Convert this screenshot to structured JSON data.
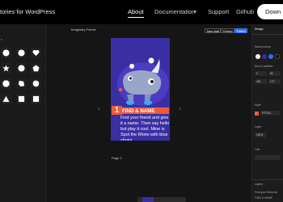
{
  "nav": {
    "brand": "tories for WordPress",
    "links": [
      {
        "label": "About",
        "active": true
      },
      {
        "label": "Documentation",
        "active": false
      },
      {
        "label": "Support",
        "active": false
      },
      {
        "label": "Github",
        "active": false
      }
    ],
    "download_label": "Down"
  },
  "left_panel": {
    "shapes_label": "s",
    "shapes": [
      "circle",
      "circle",
      "heart",
      "star",
      "circle",
      "pentagon",
      "octagon",
      "blob",
      "shape",
      "triangle",
      "square",
      "square"
    ]
  },
  "editor": {
    "doc_title": "Imaginary Friend",
    "header_buttons": [
      "Save draft",
      "Preview",
      "Publish"
    ],
    "page_label": "Page 2"
  },
  "story": {
    "step_number": "1",
    "heading": "FIND & NAME",
    "body": "Find your friend and give it a name. Then say hello but play it cool. Mine is Spot the Rhino with blue shoes."
  },
  "right_panel": {
    "design_label": "Design",
    "saved_colors_label": "Saved colors",
    "size_position_label": "Size & position",
    "size_fields": [
      "0",
      "50",
      "100",
      "172"
    ],
    "style_label": "Style",
    "color_value": "FF7324",
    "opacity_value": "100%",
    "layer_label": "Layer",
    "link_label": "Link",
    "layers_label": "Layers",
    "layer_items": [
      "Find your friend an",
      "FIND & NAME"
    ],
    "swatch_colors": [
      "#ffffff",
      "#3a2ea3",
      "#2f6df6",
      "#000000"
    ],
    "accent": "#ee5a3b"
  }
}
